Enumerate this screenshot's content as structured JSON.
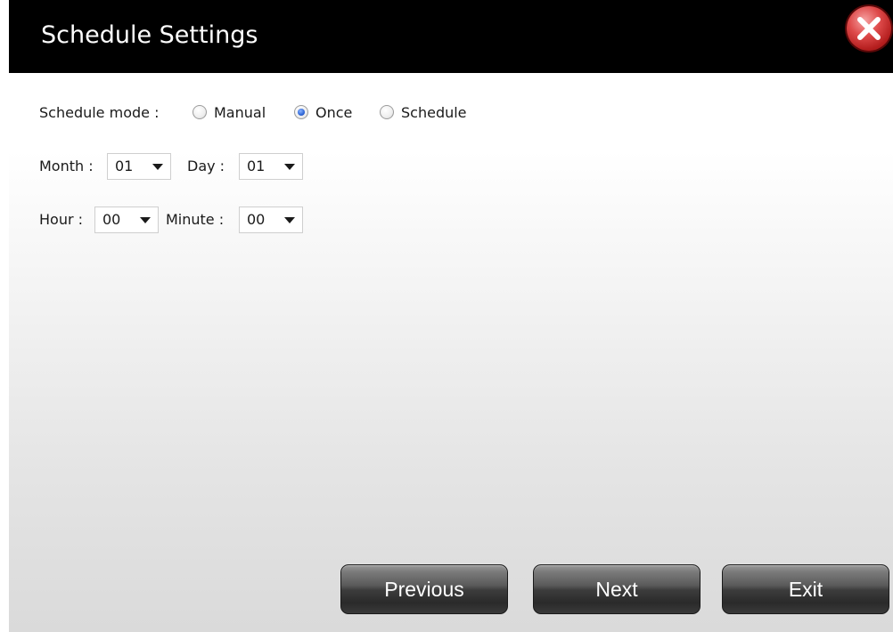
{
  "dialog": {
    "title": "Schedule Settings",
    "close_icon": "close-icon",
    "accent_color": "#cc2222"
  },
  "schedule_mode": {
    "label": "Schedule mode :",
    "options": [
      {
        "label": "Manual",
        "selected": false
      },
      {
        "label": "Once",
        "selected": true
      },
      {
        "label": "Schedule",
        "selected": false
      }
    ]
  },
  "date": {
    "month_label": "Month :",
    "month_value": "01",
    "day_label": "Day :",
    "day_value": "01"
  },
  "time": {
    "hour_label": "Hour :",
    "hour_value": "00",
    "minute_label": "Minute :",
    "minute_value": "00"
  },
  "footer": {
    "previous_label": "Previous",
    "next_label": "Next",
    "exit_label": "Exit"
  }
}
